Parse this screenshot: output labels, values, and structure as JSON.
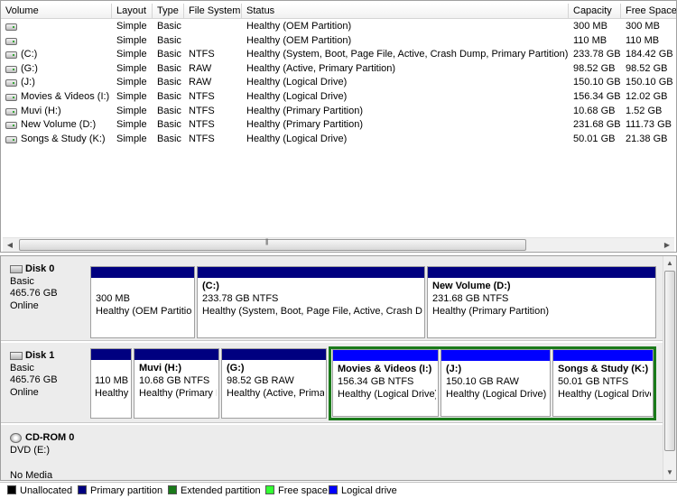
{
  "columns": [
    {
      "key": "volume",
      "label": "Volume"
    },
    {
      "key": "layout",
      "label": "Layout"
    },
    {
      "key": "type",
      "label": "Type"
    },
    {
      "key": "fs",
      "label": "File System"
    },
    {
      "key": "status",
      "label": "Status"
    },
    {
      "key": "capacity",
      "label": "Capacity"
    },
    {
      "key": "free",
      "label": "Free Space"
    }
  ],
  "volumes": [
    {
      "volume": "",
      "layout": "Simple",
      "type": "Basic",
      "fs": "",
      "status": "Healthy (OEM Partition)",
      "capacity": "300 MB",
      "free": "300 MB"
    },
    {
      "volume": "",
      "layout": "Simple",
      "type": "Basic",
      "fs": "",
      "status": "Healthy (OEM Partition)",
      "capacity": "110 MB",
      "free": "110 MB"
    },
    {
      "volume": "(C:)",
      "layout": "Simple",
      "type": "Basic",
      "fs": "NTFS",
      "status": "Healthy (System, Boot, Page File, Active, Crash Dump, Primary Partition)",
      "capacity": "233.78 GB",
      "free": "184.42 GB"
    },
    {
      "volume": "(G:)",
      "layout": "Simple",
      "type": "Basic",
      "fs": "RAW",
      "status": "Healthy (Active, Primary Partition)",
      "capacity": "98.52 GB",
      "free": "98.52 GB"
    },
    {
      "volume": "(J:)",
      "layout": "Simple",
      "type": "Basic",
      "fs": "RAW",
      "status": "Healthy (Logical Drive)",
      "capacity": "150.10 GB",
      "free": "150.10 GB"
    },
    {
      "volume": "Movies & Videos (I:)",
      "layout": "Simple",
      "type": "Basic",
      "fs": "NTFS",
      "status": "Healthy (Logical Drive)",
      "capacity": "156.34 GB",
      "free": "12.02 GB"
    },
    {
      "volume": "Muvi (H:)",
      "layout": "Simple",
      "type": "Basic",
      "fs": "NTFS",
      "status": "Healthy (Primary Partition)",
      "capacity": "10.68 GB",
      "free": "1.52 GB"
    },
    {
      "volume": "New Volume (D:)",
      "layout": "Simple",
      "type": "Basic",
      "fs": "NTFS",
      "status": "Healthy (Primary Partition)",
      "capacity": "231.68 GB",
      "free": "111.73 GB"
    },
    {
      "volume": "Songs & Study (K:)",
      "layout": "Simple",
      "type": "Basic",
      "fs": "NTFS",
      "status": "Healthy (Logical Drive)",
      "capacity": "50.01 GB",
      "free": "21.38 GB"
    }
  ],
  "disks": [
    {
      "name": "Disk 0",
      "type": "Basic",
      "size": "465.76 GB",
      "state": "Online",
      "partitions": [
        {
          "name": "",
          "size": "300 MB",
          "status": "Healthy (OEM Partition)"
        },
        {
          "name": "(C:)",
          "size": "233.78 GB NTFS",
          "status": "Healthy (System, Boot, Page File, Active, Crash Dump, Primary Partition)"
        },
        {
          "name": "New Volume  (D:)",
          "size": "231.68 GB NTFS",
          "status": "Healthy (Primary Partition)"
        }
      ]
    },
    {
      "name": "Disk 1",
      "type": "Basic",
      "size": "465.76 GB",
      "state": "Online",
      "partitions": [
        {
          "name": "",
          "size": "110 MB",
          "status": "Healthy (OEM Partition)"
        },
        {
          "name": "Muvi  (H:)",
          "size": "10.68 GB NTFS",
          "status": "Healthy (Primary Partition)"
        },
        {
          "name": "(G:)",
          "size": "98.52 GB RAW",
          "status": "Healthy (Active, Primary Partition)"
        },
        {
          "name": "Movies & Videos  (I:)",
          "size": "156.34 GB NTFS",
          "status": "Healthy (Logical Drive)"
        },
        {
          "name": "(J:)",
          "size": "150.10 GB RAW",
          "status": "Healthy (Logical Drive)"
        },
        {
          "name": "Songs & Study  (K:)",
          "size": "50.01 GB NTFS",
          "status": "Healthy (Logical Drive)"
        }
      ]
    },
    {
      "name": "CD-ROM 0",
      "type": "DVD (E:)",
      "media": "No Media"
    }
  ],
  "legend": [
    {
      "label": "Unallocated",
      "color": "#000000"
    },
    {
      "label": "Primary partition",
      "color": "#000080"
    },
    {
      "label": "Extended partition",
      "color": "#1a7a1a"
    },
    {
      "label": "Free space",
      "color": "#33ff33"
    },
    {
      "label": "Logical drive",
      "color": "#0000ff"
    }
  ],
  "colors": {
    "primary": "#000080",
    "logical": "#0000ff",
    "extended": "#1a7a1a"
  },
  "icons": {
    "volume": "hard-drive-icon",
    "disk": "disk-icon",
    "cdrom": "cd-rom-icon"
  }
}
